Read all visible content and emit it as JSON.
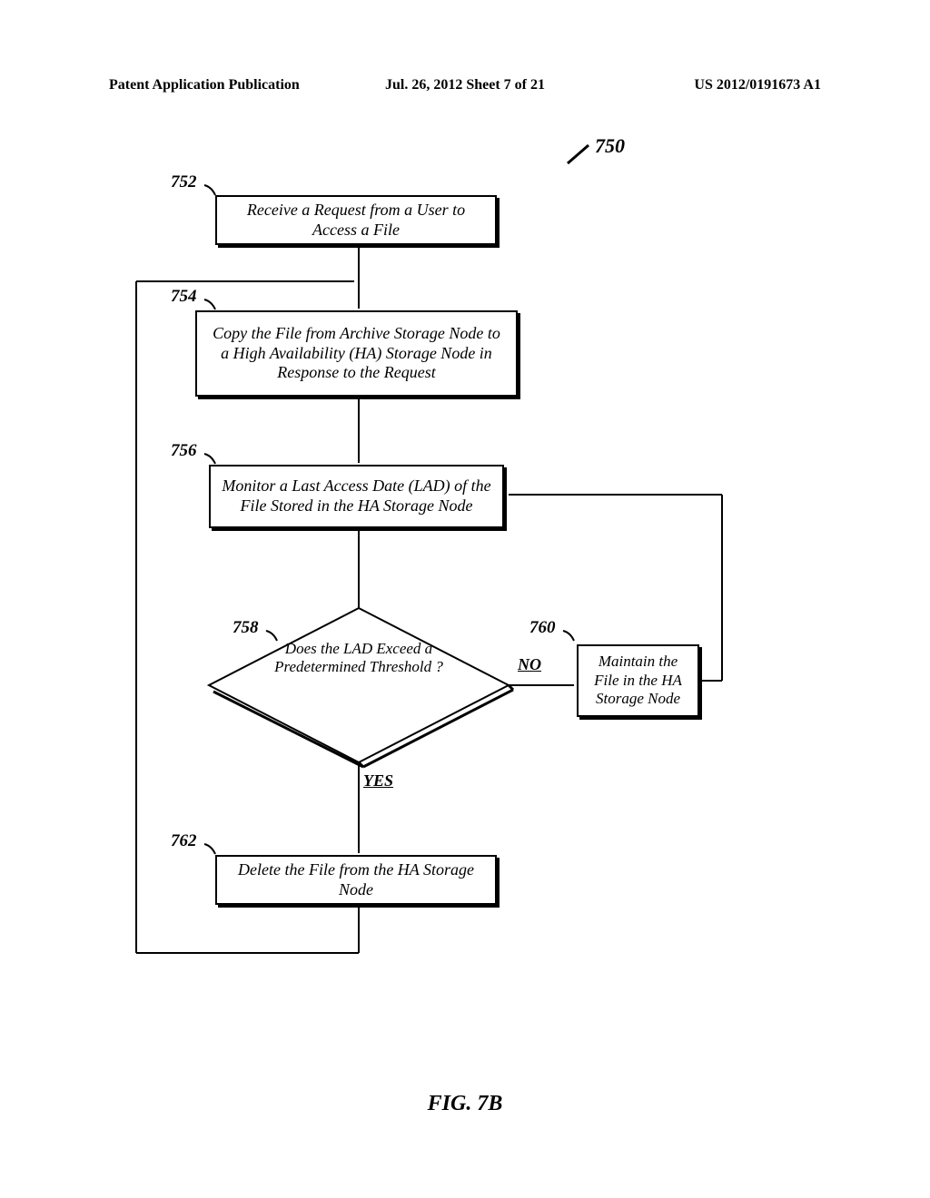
{
  "header": {
    "left": "Patent Application Publication",
    "center": "Jul. 26, 2012   Sheet 7 of 21",
    "right": "US 2012/0191673 A1"
  },
  "figure_label": "FIG. 7B",
  "ref_750": "750",
  "ref_752": "752",
  "ref_754": "754",
  "ref_756": "756",
  "ref_758": "758",
  "ref_760": "760",
  "ref_762": "762",
  "box_752": "Receive a Request from a User to Access a File",
  "box_754": "Copy the File from Archive Storage Node to a High Availability (HA) Storage Node in Response to the Request",
  "box_756": "Monitor a Last Access Date (LAD) of the File Stored in the HA Storage Node",
  "box_758": "Does the LAD Exceed a Predetermined Threshold ?",
  "box_760": "Maintain the File in the HA Storage Node",
  "box_762": "Delete the File from the HA Storage Node",
  "label_no": "NO",
  "label_yes": "YES",
  "chart_data": {
    "type": "flowchart",
    "title": "FIG. 7B",
    "overall_ref": "750",
    "nodes": [
      {
        "id": "752",
        "type": "process",
        "text": "Receive a Request from a User to Access a File"
      },
      {
        "id": "754",
        "type": "process",
        "text": "Copy the File from Archive Storage Node to a High Availability (HA) Storage Node in Response to the Request"
      },
      {
        "id": "756",
        "type": "process",
        "text": "Monitor a Last Access Date (LAD) of the File Stored in the HA Storage Node"
      },
      {
        "id": "758",
        "type": "decision",
        "text": "Does the LAD Exceed a Predetermined Threshold?"
      },
      {
        "id": "760",
        "type": "process",
        "text": "Maintain the File in the HA Storage Node"
      },
      {
        "id": "762",
        "type": "process",
        "text": "Delete the File from the HA Storage Node"
      }
    ],
    "edges": [
      {
        "from": "752",
        "to": "754",
        "label": ""
      },
      {
        "from": "754",
        "to": "756",
        "label": ""
      },
      {
        "from": "756",
        "to": "758",
        "label": ""
      },
      {
        "from": "758",
        "to": "760",
        "label": "NO"
      },
      {
        "from": "758",
        "to": "762",
        "label": "YES"
      },
      {
        "from": "760",
        "to": "756",
        "label": ""
      },
      {
        "from": "762",
        "to": "754",
        "label": "",
        "note": "loop back to before 754"
      }
    ]
  }
}
